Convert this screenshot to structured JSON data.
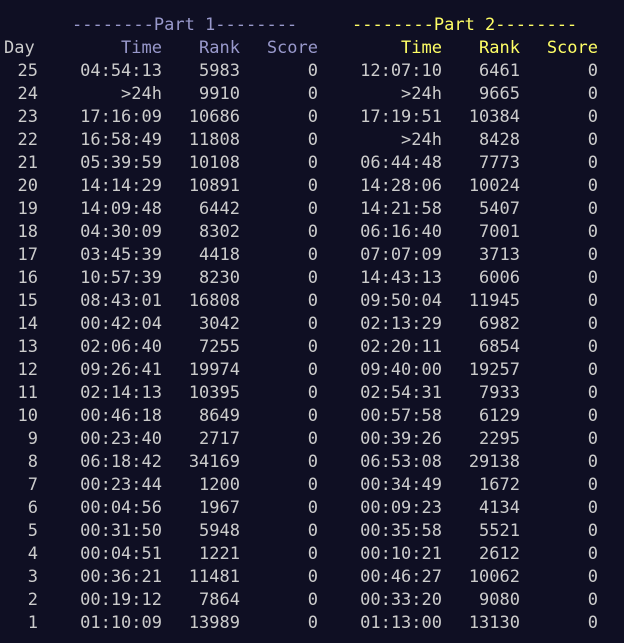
{
  "headers": {
    "part1": "--------Part 1--------",
    "part2": "--------Part 2--------",
    "day": "Day",
    "time": "Time",
    "rank": "Rank",
    "score": "Score"
  },
  "colors": {
    "background": "#0f0f23",
    "text": "#cccccc",
    "part1": "#9999cc",
    "part2": "#ffff66"
  },
  "rows": [
    {
      "day": "25",
      "t1": "04:54:13",
      "r1": "5983",
      "s1": "0",
      "t2": "12:07:10",
      "r2": "6461",
      "s2": "0"
    },
    {
      "day": "24",
      "t1": ">24h",
      "r1": "9910",
      "s1": "0",
      "t2": ">24h",
      "r2": "9665",
      "s2": "0"
    },
    {
      "day": "23",
      "t1": "17:16:09",
      "r1": "10686",
      "s1": "0",
      "t2": "17:19:51",
      "r2": "10384",
      "s2": "0"
    },
    {
      "day": "22",
      "t1": "16:58:49",
      "r1": "11808",
      "s1": "0",
      "t2": ">24h",
      "r2": "8428",
      "s2": "0"
    },
    {
      "day": "21",
      "t1": "05:39:59",
      "r1": "10108",
      "s1": "0",
      "t2": "06:44:48",
      "r2": "7773",
      "s2": "0"
    },
    {
      "day": "20",
      "t1": "14:14:29",
      "r1": "10891",
      "s1": "0",
      "t2": "14:28:06",
      "r2": "10024",
      "s2": "0"
    },
    {
      "day": "19",
      "t1": "14:09:48",
      "r1": "6442",
      "s1": "0",
      "t2": "14:21:58",
      "r2": "5407",
      "s2": "0"
    },
    {
      "day": "18",
      "t1": "04:30:09",
      "r1": "8302",
      "s1": "0",
      "t2": "06:16:40",
      "r2": "7001",
      "s2": "0"
    },
    {
      "day": "17",
      "t1": "03:45:39",
      "r1": "4418",
      "s1": "0",
      "t2": "07:07:09",
      "r2": "3713",
      "s2": "0"
    },
    {
      "day": "16",
      "t1": "10:57:39",
      "r1": "8230",
      "s1": "0",
      "t2": "14:43:13",
      "r2": "6006",
      "s2": "0"
    },
    {
      "day": "15",
      "t1": "08:43:01",
      "r1": "16808",
      "s1": "0",
      "t2": "09:50:04",
      "r2": "11945",
      "s2": "0"
    },
    {
      "day": "14",
      "t1": "00:42:04",
      "r1": "3042",
      "s1": "0",
      "t2": "02:13:29",
      "r2": "6982",
      "s2": "0"
    },
    {
      "day": "13",
      "t1": "02:06:40",
      "r1": "7255",
      "s1": "0",
      "t2": "02:20:11",
      "r2": "6854",
      "s2": "0"
    },
    {
      "day": "12",
      "t1": "09:26:41",
      "r1": "19974",
      "s1": "0",
      "t2": "09:40:00",
      "r2": "19257",
      "s2": "0"
    },
    {
      "day": "11",
      "t1": "02:14:13",
      "r1": "10395",
      "s1": "0",
      "t2": "02:54:31",
      "r2": "7933",
      "s2": "0"
    },
    {
      "day": "10",
      "t1": "00:46:18",
      "r1": "8649",
      "s1": "0",
      "t2": "00:57:58",
      "r2": "6129",
      "s2": "0"
    },
    {
      "day": "9",
      "t1": "00:23:40",
      "r1": "2717",
      "s1": "0",
      "t2": "00:39:26",
      "r2": "2295",
      "s2": "0"
    },
    {
      "day": "8",
      "t1": "06:18:42",
      "r1": "34169",
      "s1": "0",
      "t2": "06:53:08",
      "r2": "29138",
      "s2": "0"
    },
    {
      "day": "7",
      "t1": "00:23:44",
      "r1": "1200",
      "s1": "0",
      "t2": "00:34:49",
      "r2": "1672",
      "s2": "0"
    },
    {
      "day": "6",
      "t1": "00:04:56",
      "r1": "1967",
      "s1": "0",
      "t2": "00:09:23",
      "r2": "4134",
      "s2": "0"
    },
    {
      "day": "5",
      "t1": "00:31:50",
      "r1": "5948",
      "s1": "0",
      "t2": "00:35:58",
      "r2": "5521",
      "s2": "0"
    },
    {
      "day": "4",
      "t1": "00:04:51",
      "r1": "1221",
      "s1": "0",
      "t2": "00:10:21",
      "r2": "2612",
      "s2": "0"
    },
    {
      "day": "3",
      "t1": "00:36:21",
      "r1": "11481",
      "s1": "0",
      "t2": "00:46:27",
      "r2": "10062",
      "s2": "0"
    },
    {
      "day": "2",
      "t1": "00:19:12",
      "r1": "7864",
      "s1": "0",
      "t2": "00:33:20",
      "r2": "9080",
      "s2": "0"
    },
    {
      "day": "1",
      "t1": "01:10:09",
      "r1": "13989",
      "s1": "0",
      "t2": "01:13:00",
      "r2": "13130",
      "s2": "0"
    }
  ]
}
